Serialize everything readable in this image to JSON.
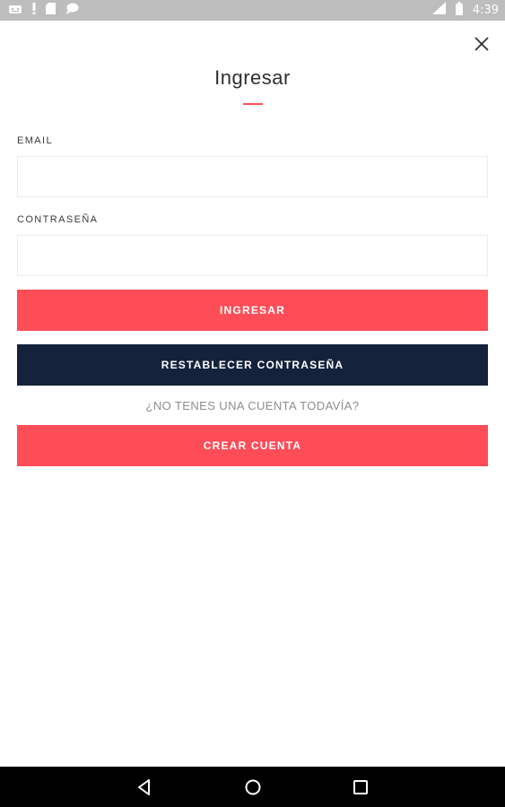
{
  "status_bar": {
    "time": "4:39",
    "left_icons": [
      "android-debug-icon",
      "alert-icon",
      "sd-card-icon",
      "chat-icon"
    ],
    "right_icons": [
      "signal-icon",
      "battery-icon"
    ]
  },
  "login": {
    "title": "Ingresar",
    "email_label": "EMAIL",
    "email_value": "",
    "password_label": "CONTRASEÑA",
    "password_value": "",
    "login_button": "INGRESAR",
    "reset_button": "RESTABLECER CONTRASEÑA",
    "no_account_prompt": "¿NO TENES UNA CUENTA TODAVÍA?",
    "create_button": "CREAR CUENTA",
    "close_icon": "close-icon"
  },
  "nav_bar": {
    "buttons": [
      "back-icon",
      "home-icon",
      "recents-icon"
    ]
  },
  "colors": {
    "accent": "#ff4d58",
    "navy": "#14233b",
    "status_bar": "#bdbdbd",
    "nav_bar": "#000000"
  }
}
